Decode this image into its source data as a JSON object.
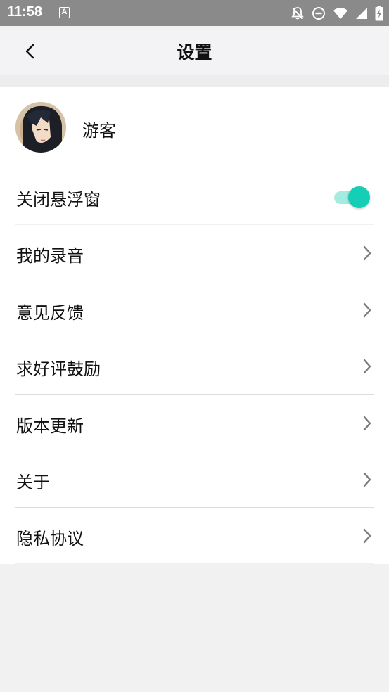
{
  "status_bar": {
    "time": "11:58",
    "notification_icon": "A",
    "icons": [
      "notifications-off-icon",
      "do-not-disturb-icon",
      "wifi-icon",
      "signal-icon",
      "battery-charging-icon"
    ]
  },
  "header": {
    "back_icon": "chevron-left-icon",
    "title": "设置"
  },
  "profile": {
    "avatar": "avatar-image",
    "name": "游客"
  },
  "settings": {
    "float_window": {
      "label": "关闭悬浮窗",
      "toggle_on": true,
      "accent_color": "#16cdb5"
    },
    "items": [
      {
        "label": "我的录音"
      },
      {
        "label": "意见反馈"
      },
      {
        "label": "求好评鼓励"
      },
      {
        "label": "版本更新"
      },
      {
        "label": "关于"
      },
      {
        "label": "隐私协议"
      }
    ]
  }
}
